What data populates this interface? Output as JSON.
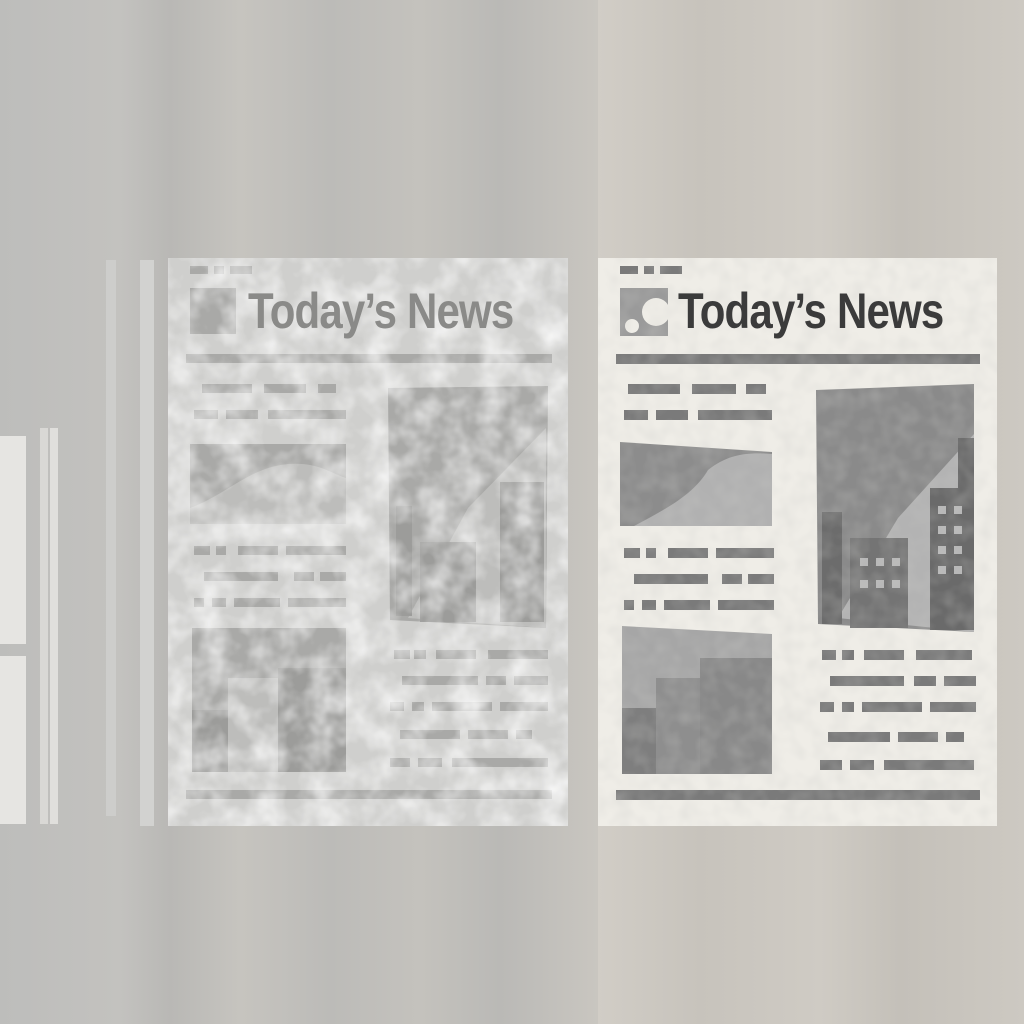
{
  "newspapers": [
    {
      "variant": "faded",
      "masthead": "Today’s News",
      "ink_color": "#8a8a88",
      "paper_color": "#cfcfcd"
    },
    {
      "variant": "clean",
      "masthead": "Today’s News",
      "ink_color": "#3b3b3b",
      "paper_color": "#efede7"
    }
  ],
  "icons": {
    "logo": "gear-emblem-icon",
    "left_photo_top": "landscape-photo-icon",
    "right_photo": "city-skyline-photo-icon",
    "left_photo_bottom": "buildings-photo-icon"
  }
}
